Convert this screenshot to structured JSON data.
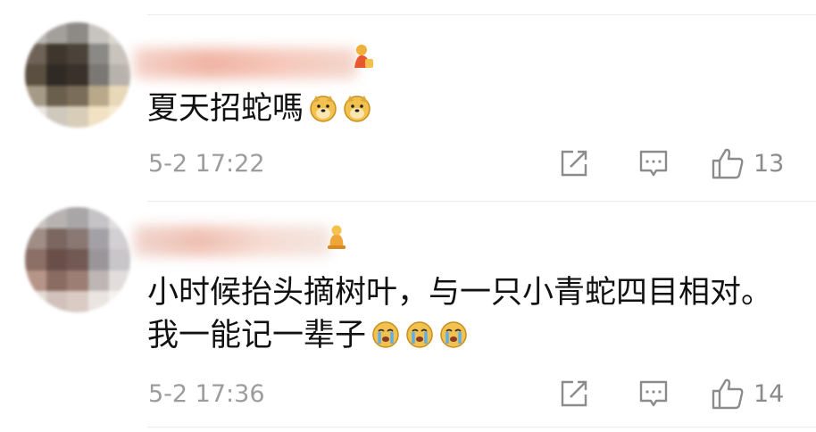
{
  "comments": [
    {
      "text_lines": [
        "夏天招蛇嗎"
      ],
      "emojis": [
        "doge-emoji",
        "doge-emoji"
      ],
      "time": "5-2 17:22",
      "likes": "13"
    },
    {
      "text_lines": [
        "小时候抬头摘树叶，与一只小青蛇四目相对。",
        "我一能记一辈子"
      ],
      "emojis": [
        "crying-emoji",
        "crying-emoji",
        "crying-emoji"
      ],
      "time": "5-2 17:36",
      "likes": "14"
    }
  ],
  "icons": {
    "share": "share-icon",
    "reply": "comment-icon",
    "like": "thumbs-up-icon"
  },
  "colors": {
    "text": "#111111",
    "meta": "#9c9c9c",
    "divider": "#ececec",
    "emoji_face": "#f3c24e"
  }
}
